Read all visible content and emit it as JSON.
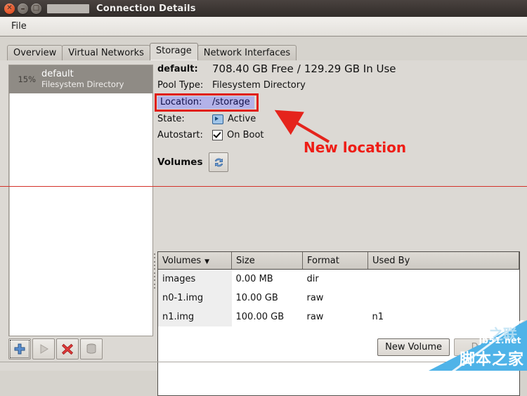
{
  "window": {
    "title": "Connection Details",
    "close_icon": "window-close",
    "minimize_icon": "window-minimize",
    "maximize_icon": "window-maximize"
  },
  "menu": {
    "items": [
      {
        "label": "File"
      }
    ]
  },
  "tabs": [
    {
      "label": "Overview",
      "active": false
    },
    {
      "label": "Virtual Networks",
      "active": false
    },
    {
      "label": "Storage",
      "active": true
    },
    {
      "label": "Network Interfaces",
      "active": false
    }
  ],
  "pool_list": {
    "items": [
      {
        "percent": "15%",
        "name": "default",
        "type": "Filesystem Directory",
        "selected": true
      }
    ]
  },
  "details": {
    "pool_name_label": "default:",
    "free_text": "708.40 GB Free",
    "separator": "/",
    "in_use_text": "129.29 GB In Use",
    "pool_type_label": "Pool Type:",
    "pool_type_value": "Filesystem Directory",
    "location_label": "Location:",
    "location_value": "/storage",
    "state_label": "State:",
    "state_value": "Active",
    "state_icon": "screen-icon",
    "autostart_label": "Autostart:",
    "autostart_value": "On Boot",
    "autostart_checked": true,
    "volumes_title": "Volumes",
    "refresh_icon": "refresh-icon"
  },
  "volumes_table": {
    "columns": [
      "Volumes",
      "Size",
      "Format",
      "Used By"
    ],
    "sort_column": "Volumes",
    "sort_caret": "▼",
    "rows": [
      {
        "name": "images",
        "size": "0.00 MB",
        "format": "dir",
        "used_by": ""
      },
      {
        "name": "n0-1.img",
        "size": "10.00 GB",
        "format": "raw",
        "used_by": ""
      },
      {
        "name": "n1.img",
        "size": "100.00 GB",
        "format": "raw",
        "used_by": "n1"
      }
    ]
  },
  "toolbar": {
    "add_icon": "plus-icon",
    "start_icon": "play-icon",
    "stop_icon": "red-x-icon",
    "delete_icon": "trash-icon"
  },
  "buttons": {
    "new_volume": "New Volume",
    "delete": "Delete",
    "delete_disabled": true
  },
  "annotation": {
    "text": "New location",
    "color": "#ee1d16",
    "arrow_icon": "arrow-icon",
    "highlight_box_color": "#e01b12",
    "highlight_fill_color": "#b3b2e8",
    "line_color": "#d4322a"
  },
  "watermark": {
    "site": "jb51.net",
    "name": "脚本之家",
    "ghost": "之联"
  }
}
